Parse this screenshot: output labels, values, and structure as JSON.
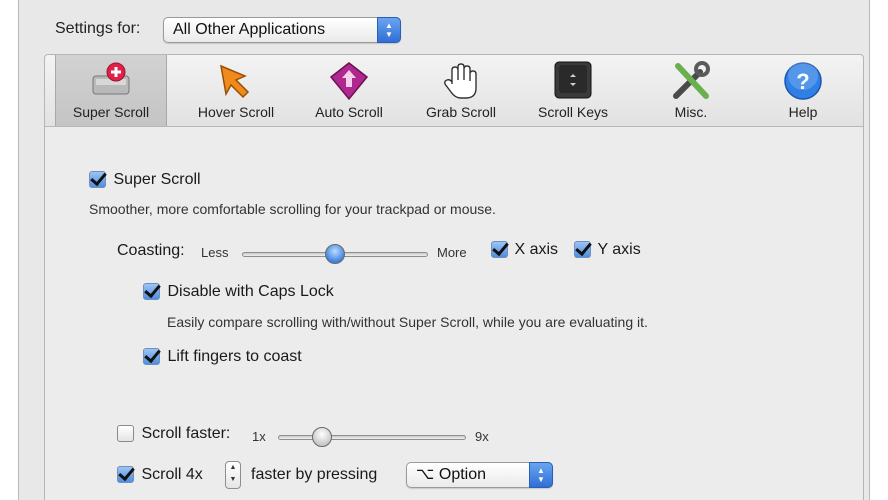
{
  "header": {
    "settings_label": "Settings for:",
    "app_select_value": "All Other Applications"
  },
  "toolbar": {
    "items": [
      {
        "label": "Super Scroll",
        "icon": "super-scroll-icon"
      },
      {
        "label": "Hover Scroll",
        "icon": "hover-scroll-icon"
      },
      {
        "label": "Auto Scroll",
        "icon": "auto-scroll-icon"
      },
      {
        "label": "Grab Scroll",
        "icon": "grab-scroll-icon"
      },
      {
        "label": "Scroll Keys",
        "icon": "scroll-keys-icon"
      },
      {
        "label": "Misc.",
        "icon": "misc-tools-icon"
      },
      {
        "label": "Help",
        "icon": "help-icon"
      }
    ],
    "selected": "Super Scroll"
  },
  "super_scroll": {
    "enable_label": "Super Scroll",
    "enabled": true,
    "description": "Smoother, more comfortable scrolling for your trackpad or mouse.",
    "coasting": {
      "label": "Coasting:",
      "min_label": "Less",
      "max_label": "More",
      "value": 0.5,
      "x_axis_label": "X axis",
      "x_axis_checked": true,
      "y_axis_label": "Y axis",
      "y_axis_checked": true
    },
    "caps_lock": {
      "label": "Disable with Caps Lock",
      "checked": true,
      "description": "Easily compare scrolling with/without Super Scroll, while you are evaluating it."
    },
    "lift_fingers": {
      "label": "Lift fingers to coast",
      "checked": true
    }
  },
  "scroll_faster": {
    "label": "Scroll faster:",
    "checked": false,
    "min_label": "1x",
    "max_label": "9x",
    "value": 0.2
  },
  "scroll_multiplier": {
    "label": "Scroll 4x",
    "checked": true,
    "suffix_label": "faster by pressing",
    "modifier_value": "⌥ Option"
  },
  "colors": {
    "accent": "#3e82e0",
    "window_bg": "#e8e8e8"
  }
}
